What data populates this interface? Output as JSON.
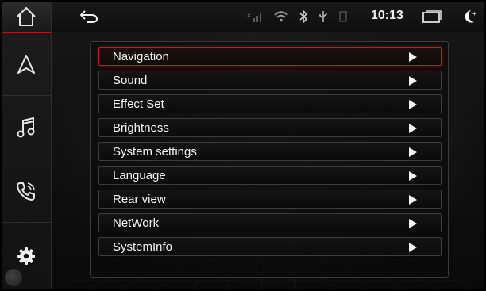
{
  "status_bar": {
    "clock": "10:13"
  },
  "dock": {
    "items": [
      "home-icon",
      "navigation-icon",
      "music-icon",
      "phone-icon",
      "settings-icon"
    ]
  },
  "menu": {
    "items": [
      {
        "label": "Navigation",
        "selected": true
      },
      {
        "label": "Sound",
        "selected": false
      },
      {
        "label": "Effect Set",
        "selected": false
      },
      {
        "label": "Brightness",
        "selected": false
      },
      {
        "label": "System settings",
        "selected": false
      },
      {
        "label": "Language",
        "selected": false
      },
      {
        "label": "Rear view",
        "selected": false
      },
      {
        "label": "NetWork",
        "selected": false
      },
      {
        "label": "SystemInfo",
        "selected": false
      }
    ]
  },
  "colors": {
    "accent": "#b3211e",
    "background": "#0b0b0b",
    "text": "#f4f4f4"
  }
}
